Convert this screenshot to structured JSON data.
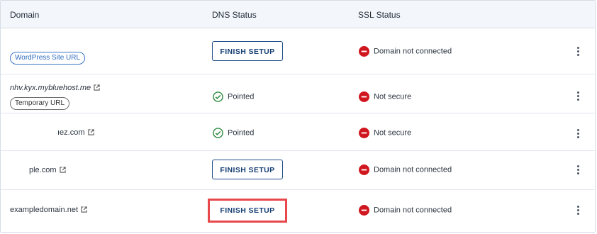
{
  "header": {
    "domain": "Domain",
    "dns_status": "DNS Status",
    "ssl_status": "SSL Status"
  },
  "rows": [
    {
      "domain": "",
      "tag": "WordPress Site URL",
      "dns": {
        "type": "button",
        "label": "FINISH SETUP"
      },
      "ssl": {
        "status": "error",
        "label": "Domain not connected"
      }
    },
    {
      "domain": "nhv.kyx.mybluehost.me",
      "tag": "Temporary URL",
      "dns": {
        "type": "status",
        "status": "ok",
        "label": "Pointed"
      },
      "ssl": {
        "status": "error",
        "label": "Not secure"
      }
    },
    {
      "domain": "ıez.com",
      "dns": {
        "type": "status",
        "status": "ok",
        "label": "Pointed"
      },
      "ssl": {
        "status": "error",
        "label": "Not secure"
      }
    },
    {
      "domain": "ple.com",
      "dns": {
        "type": "button",
        "label": "FINISH SETUP"
      },
      "ssl": {
        "status": "error",
        "label": "Domain not connected"
      }
    },
    {
      "domain": "exampledomain.net",
      "dns": {
        "type": "button",
        "label": "FINISH SETUP",
        "highlighted": true
      },
      "ssl": {
        "status": "error",
        "label": "Domain not connected"
      }
    }
  ],
  "colors": {
    "ok": "#2e8b3d",
    "error": "#d0171f",
    "highlight": "#e8474c",
    "button": "#1d4d8a"
  },
  "icons": {
    "external": "external-link-icon",
    "ok": "check-circle-icon",
    "error": "minus-circle-icon",
    "menu": "kebab-menu-icon"
  }
}
